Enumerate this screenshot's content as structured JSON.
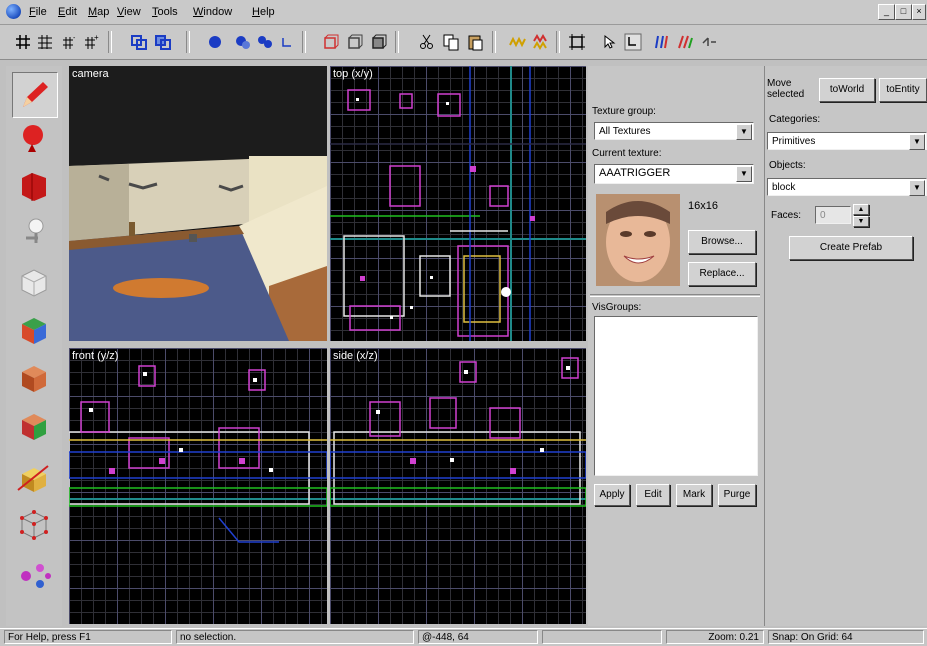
{
  "menu": {
    "items": [
      "File",
      "Edit",
      "Map",
      "View",
      "Tools",
      "Window",
      "Help"
    ],
    "underline": [
      "F",
      "E",
      "M",
      "V",
      "T",
      "W",
      "H"
    ],
    "rest": [
      "ile",
      "dit",
      "ap",
      "iew",
      "ools",
      "indow",
      "elp"
    ]
  },
  "window_controls": {
    "minimize": "_",
    "maximize": "□",
    "close": "×"
  },
  "viewports": {
    "camera": {
      "label": "camera"
    },
    "top": {
      "label": "top (x/y)"
    },
    "front": {
      "label": "front (y/z)"
    },
    "side": {
      "label": "side (x/z)"
    }
  },
  "texture_panel": {
    "group_label": "Texture group:",
    "group_value": "All Textures",
    "current_label": "Current texture:",
    "current_value": "AAATRIGGER",
    "size": "16x16",
    "browse": "Browse...",
    "replace": "Replace..."
  },
  "visgroups": {
    "label": "VisGroups:",
    "apply": "Apply",
    "edit": "Edit",
    "mark": "Mark",
    "purge": "Purge"
  },
  "object_panel": {
    "move_selected": "Move selected",
    "to_world": "toWorld",
    "to_entity": "toEntity",
    "categories_label": "Categories:",
    "categories_value": "Primitives",
    "objects_label": "Objects:",
    "objects_value": "block",
    "faces_label": "Faces:",
    "faces_value": "0",
    "create_prefab": "Create Prefab"
  },
  "status": {
    "help": "For Help, press F1",
    "selection": "no selection.",
    "coords": "@-448, 64",
    "blank": "",
    "zoom": "Zoom: 0.21",
    "snap": "Snap: On Grid: 64"
  },
  "colors": {
    "grid_major": "#4b4b6a",
    "axis": "#1f8a8a",
    "brush_magenta": "#d040d0",
    "brush_white": "#e8e8e8",
    "brush_yellow": "#e0c040"
  }
}
